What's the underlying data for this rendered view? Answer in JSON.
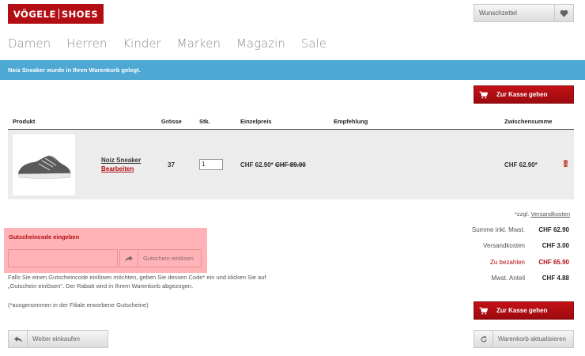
{
  "header": {
    "logo_left": "VÖGELE",
    "logo_right": "SHOES",
    "wishlist_label": "Wunschzettel",
    "wishlist_icon": "heart-icon"
  },
  "nav": {
    "items": [
      "Damen",
      "Herren",
      "Kinder",
      "Marken",
      "Magazin",
      "Sale"
    ]
  },
  "notice": "Noiz Sneaker wurde in Ihren Warenkorb gelegt.",
  "checkout_label": "Zur Kasse gehen",
  "table": {
    "headers": {
      "product": "Produkt",
      "size": "Grösse",
      "qty": "Stk.",
      "unit_price": "Einzelpreis",
      "recommendation": "Empfehlung",
      "subtotal": "Zwischensumme"
    },
    "rows": [
      {
        "name": "Noiz Sneaker",
        "edit": "Bearbeiten",
        "size": "37",
        "qty": "1",
        "price": "CHF 62.90*",
        "old_price": "CHF 89.90",
        "subtotal": "CHF 62.90*"
      }
    ]
  },
  "shipping_note": {
    "prefix": "*zzgl.",
    "link": "Versandkosten"
  },
  "coupon": {
    "title": "Gutscheincode eingeben",
    "placeholder": "",
    "button": "Gutschein einlösen",
    "help": "Falls Sie einen Gutscheincode einlösen möchten, geben Sie dessen Code* ein und klicken Sie auf „Gutschein einlösen\". Der Rabatt wird in Ihrem Warenkorb abgezogen.",
    "note": "(*ausgenommen in der Filiale erworbene Gutscheine)"
  },
  "totals": [
    {
      "label": "Summe inkl. Mwst.",
      "value": "CHF 62.90"
    },
    {
      "label": "Versandkosten",
      "value": "CHF 3.00"
    },
    {
      "label": "Zu bezahlen",
      "value": "CHF 65.90"
    },
    {
      "label": "Mwst. Anteil",
      "value": "CHF 4.88"
    }
  ],
  "buttons": {
    "continue_shopping": "Weiter einkaufen",
    "update_cart": "Warenkorb aktualisieren"
  },
  "colors": {
    "brand_red": "#b30e14",
    "notice_blue": "#4fa8d3",
    "coupon_highlight": "#ffb3b6"
  }
}
